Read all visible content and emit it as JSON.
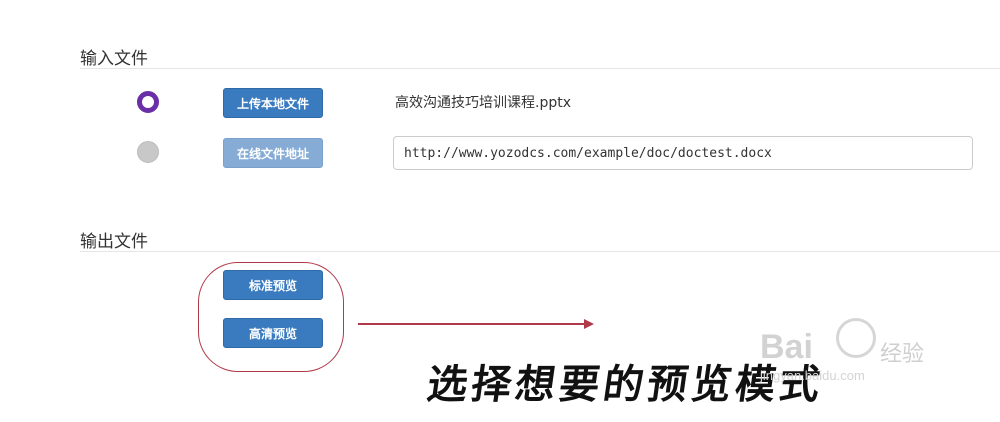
{
  "input_section": {
    "title": "输入文件",
    "upload_button": "上传本地文件",
    "online_button": "在线文件地址",
    "file_name": "高效沟通技巧培训课程.pptx",
    "url_value": "http://www.yozodcs.com/example/doc/doctest.docx",
    "selected_option": "upload"
  },
  "output_section": {
    "title": "输出文件",
    "standard_preview_button": "标准预览",
    "hd_preview_button": "高清预览"
  },
  "annotation": {
    "caption": "选择想要的预览模式",
    "color": "#b03a4a"
  },
  "watermark": {
    "brand": "Bai",
    "sub": "经验",
    "url": "jingyan.baidu.com"
  },
  "colors": {
    "button": "#3a7bbf",
    "button_muted": "#86acd5",
    "radio_selected": "#6a2fa8",
    "radio_unselected": "#c8c8c8"
  }
}
